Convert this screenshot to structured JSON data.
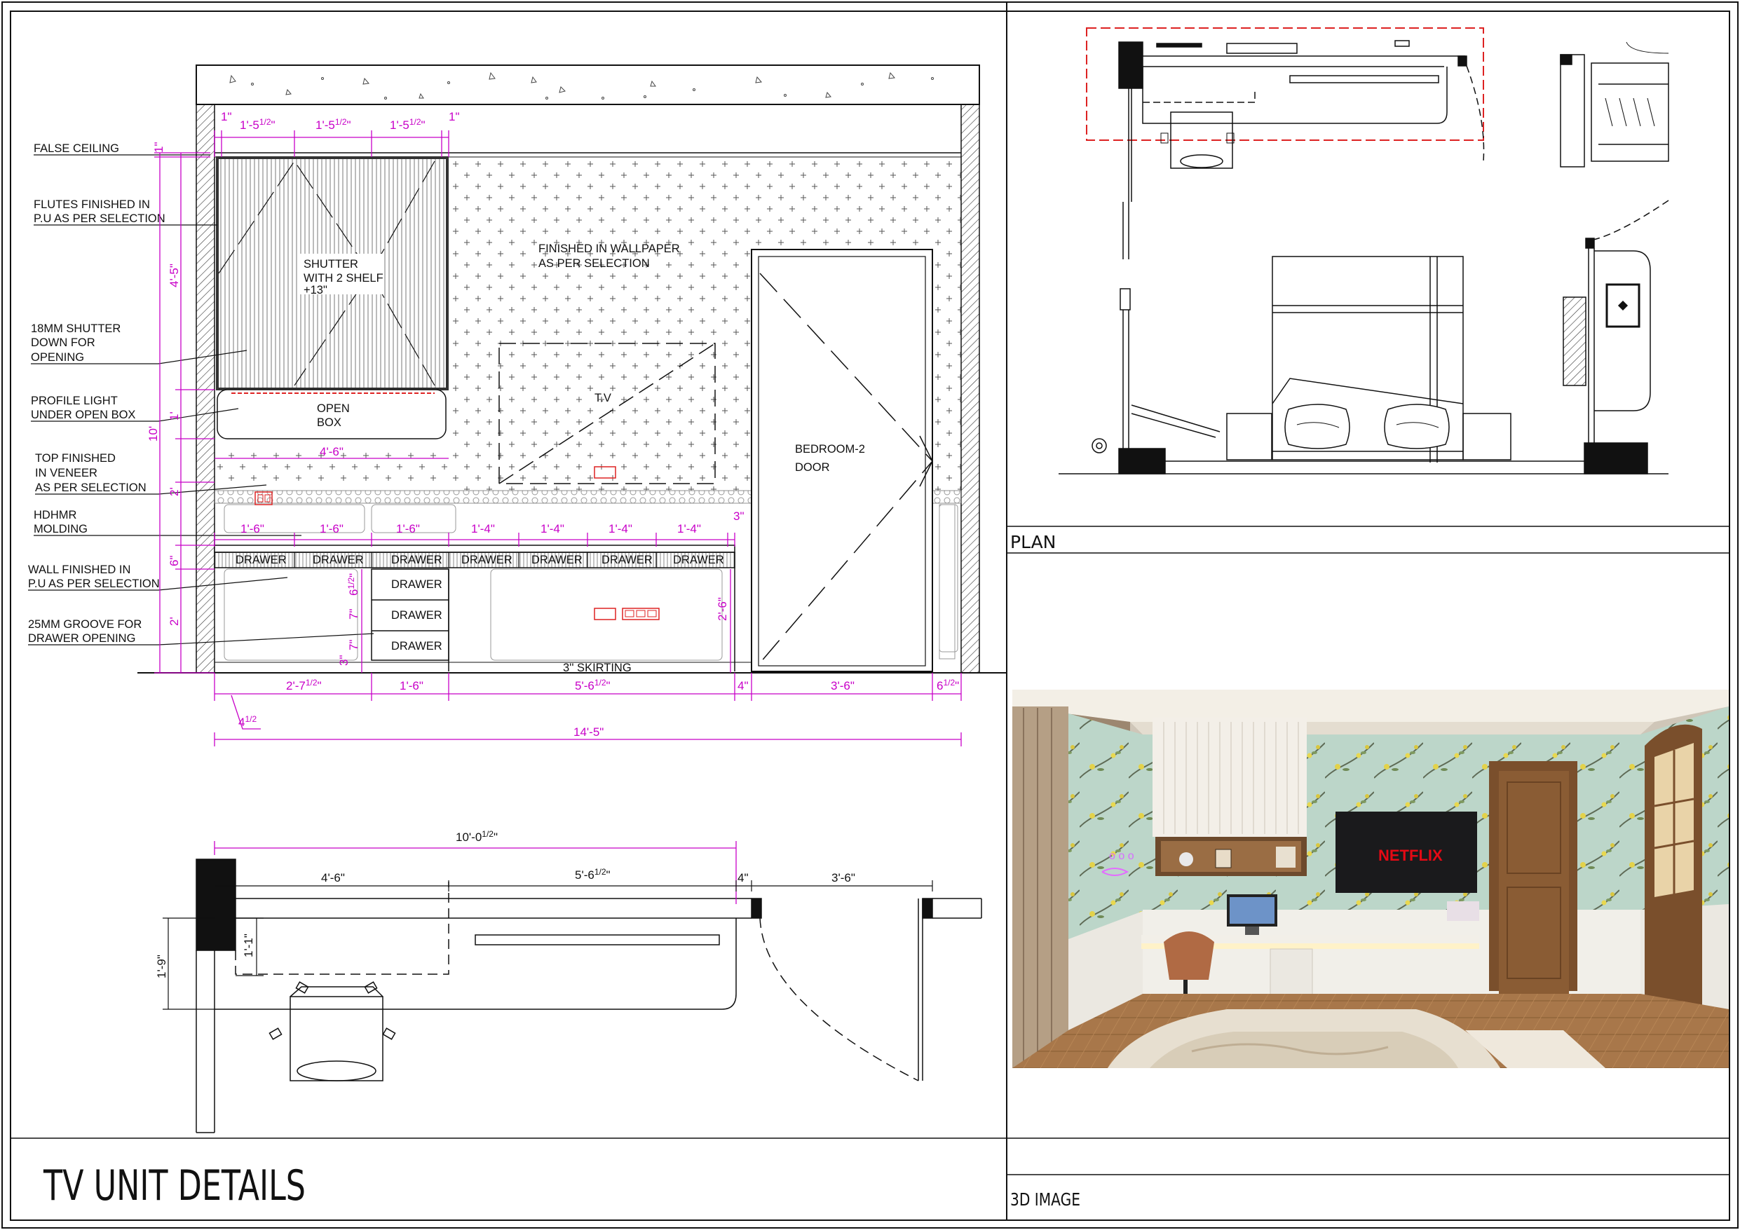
{
  "sheet": {
    "title": "TV UNIT DETAILS",
    "plan_caption": "PLAN",
    "image_caption": "3D IMAGE"
  },
  "elevation": {
    "notes": [
      "FALSE CEILING",
      "FLUTES FINISHED IN",
      "P.U AS PER SELECTION",
      "18MM SHUTTER",
      "DOWN FOR",
      "OPENING",
      "PROFILE LIGHT",
      "UNDER OPEN BOX",
      "TOP FINISHED",
      "IN VENEER",
      "AS PER SELECTION",
      "HDHMR",
      "MOLDING",
      "WALL FINISHED IN",
      "P.U AS PER SELECTION",
      "25MM GROOVE FOR",
      "DRAWER OPENING"
    ],
    "shutter_text": [
      "SHUTTER",
      "WITH 2 SHELF",
      "+13\""
    ],
    "open_box": [
      "OPEN",
      "BOX"
    ],
    "wallpaper": [
      "FINISHED IN WALLPAPER",
      "AS PER SELECTION"
    ],
    "tv": "T.V",
    "door": [
      "BEDROOM-2",
      "DOOR"
    ],
    "skirting": "3'' SKIRTING",
    "drawer": "DRAWER",
    "top_dims": [
      "1\"",
      "1'-5",
      "1/2",
      "\"",
      "1'-5",
      "1/2",
      "\"",
      "1'-5",
      "1/2",
      "\"",
      "1\""
    ],
    "drawer_dims": [
      "1'-6\"",
      "1'-6\"",
      "1'-6\"",
      "1'-4\"",
      "1'-4\"",
      "1'-4\"",
      "1'-4\"",
      "3\""
    ],
    "left_dims": [
      "1\"",
      "4'-5\"",
      "1'",
      "2'",
      "6\"",
      "2'",
      "10'"
    ],
    "inner_dims": [
      "6",
      "1/2",
      "\"",
      "7\"",
      "7\"",
      "3\"",
      "2'-6\"",
      "4'-6\""
    ],
    "bottom_dims": [
      "2'-7",
      "1/2",
      "\"",
      "1'-6\"",
      "5'-6",
      "1/2",
      "\"",
      "4\"",
      "3'-6\"",
      "6",
      "1/2",
      "\"",
      "4",
      "1/2",
      "14'-5\""
    ]
  },
  "plan_detail": {
    "dims": [
      "10'-0",
      "1/2",
      "\"",
      "4'-6\"",
      "5'-6",
      "1/2",
      "\"",
      "4\"",
      "3'-6\"",
      "1'-9\"",
      "1'-1\""
    ]
  },
  "render": {
    "netflix": "NETFLIX",
    "colors": {
      "wall": "#bcd6c9",
      "wood": "#7a4f2c",
      "floor": "#a8774a",
      "wainscot": "#f1efe9"
    }
  },
  "colors": {
    "dimension": "#c800c8",
    "highlight": "#dd2222",
    "line": "#111111"
  }
}
